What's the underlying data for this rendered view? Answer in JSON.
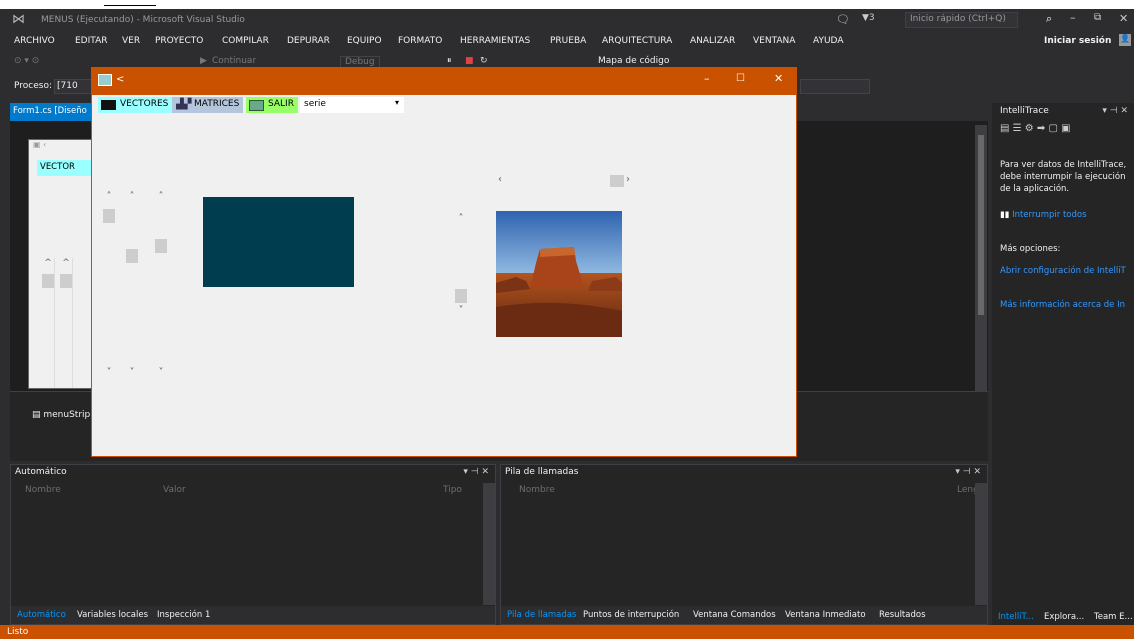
{
  "titlebar": {
    "title": "MENUS (Ejecutando) - Microsoft Visual Studio",
    "notif_count": "3",
    "quick_launch": "Inicio rápido (Ctrl+Q)"
  },
  "menu": [
    "ARCHIVO",
    "EDITAR",
    "VER",
    "PROYECTO",
    "COMPILAR",
    "DEPURAR",
    "EQUIPO",
    "FORMATO",
    "HERRAMIENTAS",
    "PRUEBA",
    "ARQUITECTURA",
    "ANALIZAR",
    "VENTANA",
    "AYUDA"
  ],
  "signin": "Iniciar sesión",
  "toolbar": {
    "continue": "Continuar",
    "config": "Debug",
    "codemap": "Mapa de código"
  },
  "process_label": "Proceso:",
  "process_value": "[710",
  "doc_tab": "Form1.cs [Diseño",
  "designer_menu_item": "VECTOR",
  "tray_item": "menuStrip",
  "form": {
    "title": "<",
    "menu": [
      {
        "label": "VECTORES",
        "bg": "#99ffff"
      },
      {
        "label": "MATRICES",
        "bg": "#b4c6dc"
      },
      {
        "label": "SALIR",
        "bg": "#99ff66"
      }
    ],
    "combo_value": "serie",
    "panel_color": "#003d4f"
  },
  "autos": {
    "title": "Automático",
    "col_name": "Nombre",
    "col_value": "Valor",
    "col_type": "Tipo"
  },
  "callstack": {
    "title": "Pila de llamadas",
    "col_name": "Nombre",
    "col_lang": "Leng"
  },
  "bottom_tabs_left": [
    "Automático",
    "Variables locales",
    "Inspección 1"
  ],
  "bottom_tabs_right": [
    "Pila de llamadas",
    "Puntos de interrupción",
    "Ventana Comandos",
    "Ventana Inmediato",
    "Resultados"
  ],
  "intellitrace": {
    "title": "IntelliTrace",
    "message": "Para ver datos de IntelliTrace, debe interrumpir la ejecución de la aplicación.",
    "break_all": "Interrumpir todos",
    "more_options": "Más opciones:",
    "link_config": "Abrir configuración de IntelliT",
    "link_info": "Más información acerca de In"
  },
  "right_tabs": [
    "IntelliT...",
    "Explora...",
    "Team E..."
  ],
  "status": "Listo"
}
